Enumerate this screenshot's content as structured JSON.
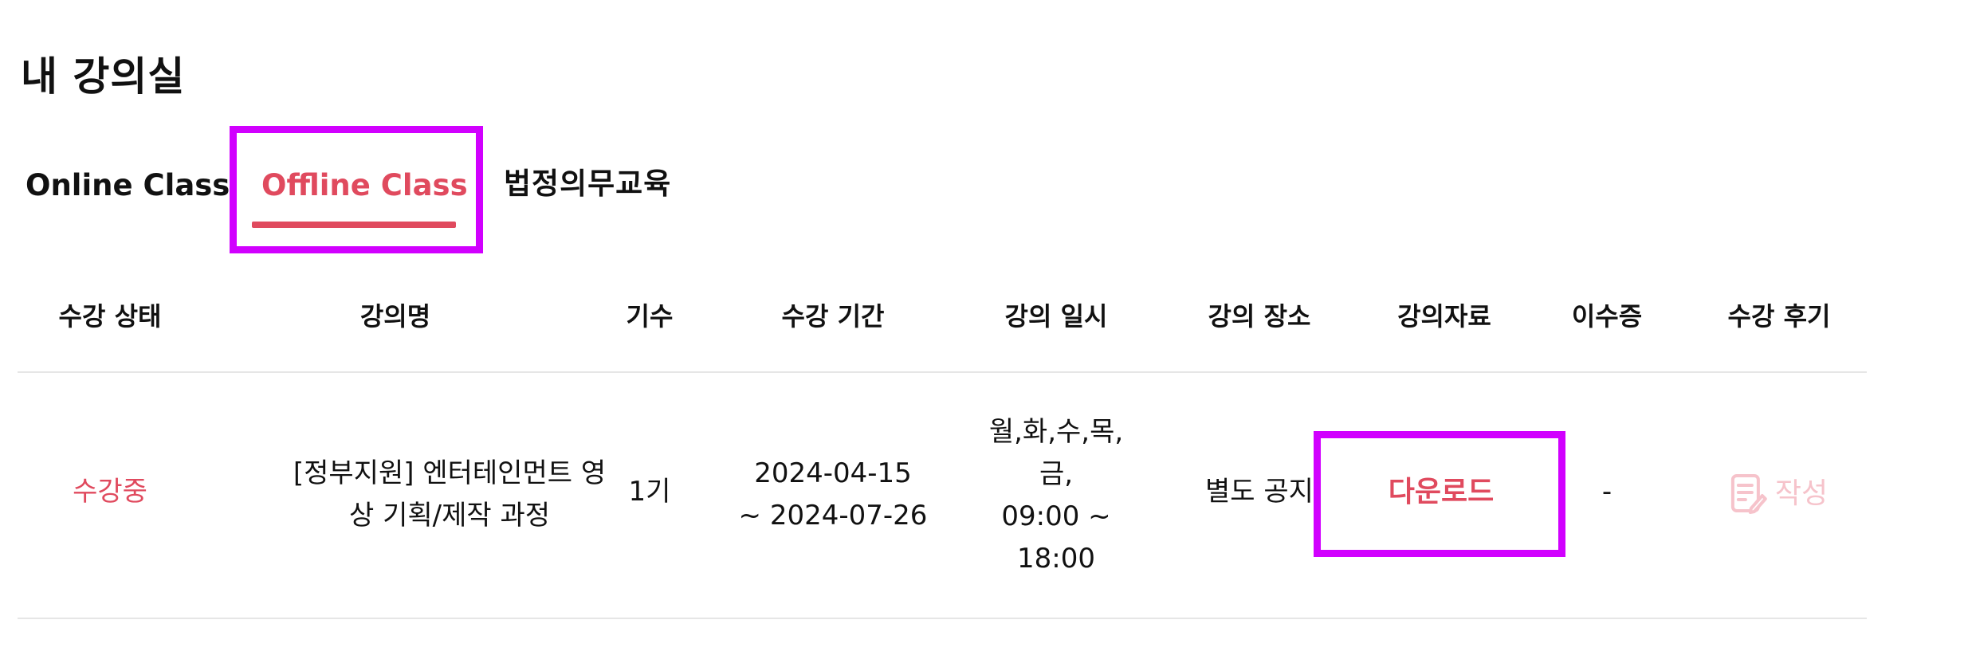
{
  "page": {
    "title": "내 강의실"
  },
  "tabs": [
    {
      "label": "Online Class",
      "active": false
    },
    {
      "label": "Offline Class",
      "active": true
    },
    {
      "label": "법정의무교육",
      "active": false
    }
  ],
  "colors": {
    "accent": "#e04a5e",
    "highlight": "#d100ff",
    "review_disabled": "#f6c3cb"
  },
  "table": {
    "headers": [
      "수강 상태",
      "강의명",
      "기수",
      "수강 기간",
      "강의 일시",
      "강의 장소",
      "강의자료",
      "이수증",
      "수강 후기"
    ],
    "rows": [
      {
        "status": "수강중",
        "course_name_line1": "[정부지원] 엔터테인먼트 영",
        "course_name_line2": "상 기획/제작 과정",
        "cohort": "1기",
        "period_line1": "2024-04-15",
        "period_line2": "~ 2024-07-26",
        "schedule_line1": "월,화,수,목,",
        "schedule_line2": "금,",
        "schedule_line3": "09:00 ~",
        "schedule_line4": "18:00",
        "location": "별도 공지",
        "materials": "다운로드",
        "certificate": "-",
        "review_label": "작성",
        "review_icon": "write-icon"
      }
    ]
  }
}
